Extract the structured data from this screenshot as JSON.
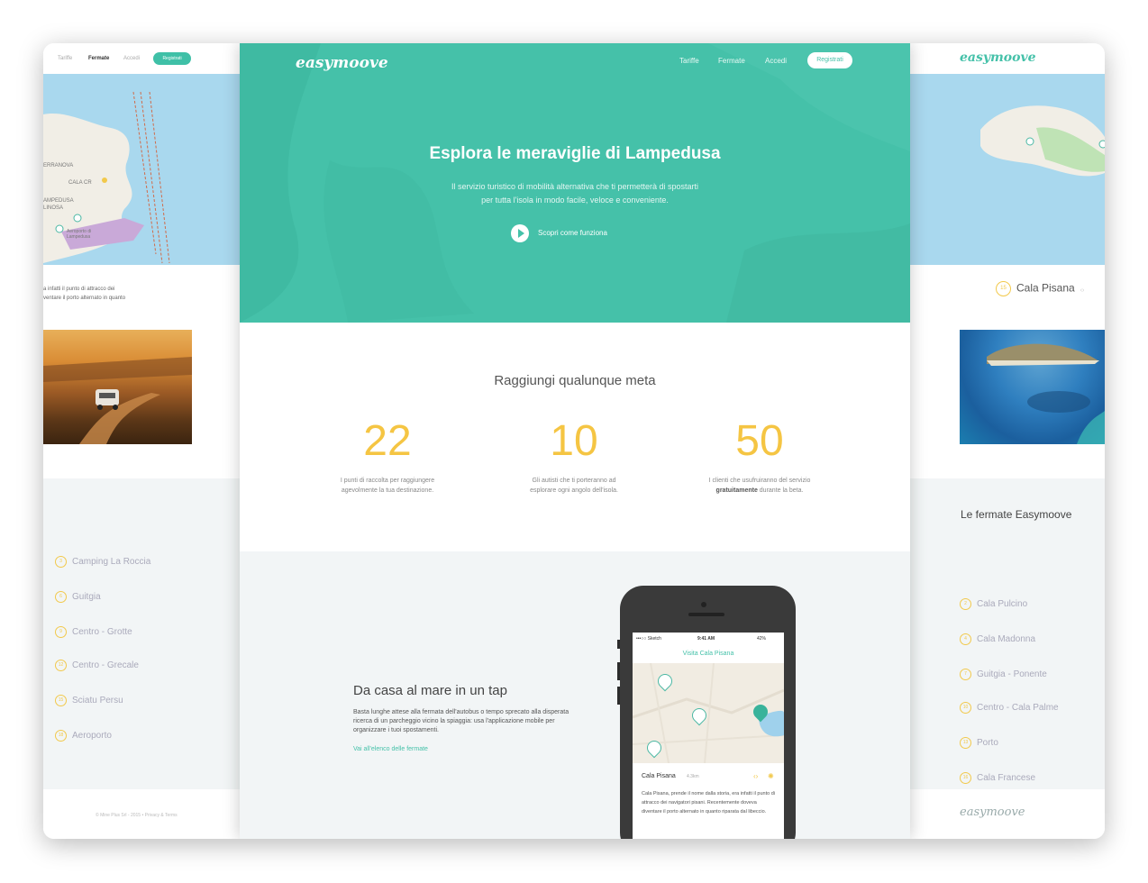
{
  "left_panel": {
    "nav": [
      "Tariffe",
      "Fermate",
      "Accedi"
    ],
    "register": "Registrati",
    "map_labels": [
      "ERRANOVA",
      "CALA CR",
      "AMPEDUSA",
      "LINOSA",
      "Aeroporto di Lampedusa"
    ],
    "text_lines": [
      "a infatti il punto di attracco dei",
      "ventare il porto alternato in quanto"
    ],
    "stops": [
      {
        "num": "3",
        "name": "Camping La Roccia"
      },
      {
        "num": "6",
        "name": "Guitgia"
      },
      {
        "num": "9",
        "name": "Centro - Grotte"
      },
      {
        "num": "12",
        "name": "Centro - Grecale"
      },
      {
        "num": "15",
        "name": "Sciatu Persu"
      },
      {
        "num": "18",
        "name": "Aeroporto"
      }
    ],
    "footer": "© Mine Plus Srl - 2015  •  Privacy & Terms"
  },
  "center": {
    "logo": "easymoove",
    "nav": [
      "Tariffe",
      "Fermate",
      "Accedi"
    ],
    "register": "Registrati",
    "hero_title": "Esplora le meraviglie di Lampedusa",
    "hero_sub_1": "Il servizio turistico di mobilità alternativa che ti permetterà di spostarti",
    "hero_sub_2": "per tutta l'isola in modo facile, veloce e conveniente.",
    "cta": "Scopri come funziona",
    "stats_title": "Raggiungi qualunque meta",
    "stats": [
      {
        "num": "22",
        "desc1": "I punti di raccolta per raggiungere",
        "desc2": "agevolmente la tua destinazione."
      },
      {
        "num": "10",
        "desc1": "Gli autisti che ti porteranno ad",
        "desc2": "esplorare ogni angolo dell'isola."
      },
      {
        "num": "50",
        "desc1": "I clienti che usufruiranno del servizio",
        "desc2_bold": "gratuitamente",
        "desc2_rest": " durante la beta."
      }
    ],
    "app_title": "Da casa al mare in un tap",
    "app_body": "Basta lunghe attese alla fermata dell'autobus o tempo sprecato alla disperata ricerca di un parcheggio vicino la spiaggia: usa l'applicazione mobile per organizzare i tuoi spostamenti.",
    "app_link": "Vai all'elenco delle fermate",
    "phone": {
      "carrier": "•••○○ Sketch",
      "time": "9:41 AM",
      "battery": "42%",
      "screen_title": "Visita Cala Pisana",
      "card_title": "Cala Pisana",
      "card_dist": "4.3km",
      "card_desc": "Cala Pisana, prende il nome dalla storia, era infatti il punto di attracco dei navigatori pisani. Recentemente doveva diventare il porto alternato in quanto riparata dal libeccio."
    }
  },
  "right_panel": {
    "logo": "easymoove",
    "current_num": "15",
    "current_stop": "Cala Pisana",
    "list_title": "Le fermate Easymoove",
    "stops": [
      {
        "num": "2",
        "name": "Cala Pulcino"
      },
      {
        "num": "4",
        "name": "Cala Madonna"
      },
      {
        "num": "7",
        "name": "Guitgia - Ponente"
      },
      {
        "num": "10",
        "name": "Centro - Cala Palme"
      },
      {
        "num": "13",
        "name": "Porto"
      },
      {
        "num": "16",
        "name": "Cala Francese"
      }
    ],
    "footer_logo": "easymoove"
  },
  "colors": {
    "accent": "#45c1a9",
    "yellow": "#f5c543",
    "map_water": "#a9d8ee"
  }
}
